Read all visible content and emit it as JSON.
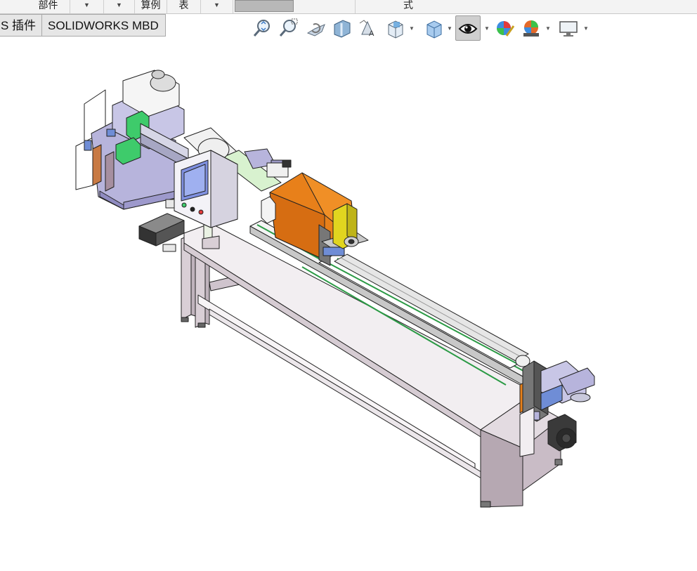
{
  "ribbon": {
    "items": [
      {
        "label": "部件"
      },
      {
        "label": "▼"
      },
      {
        "label": "▼"
      },
      {
        "label": "算例"
      },
      {
        "label": "表"
      },
      {
        "label": "▼"
      },
      {
        "label": ""
      },
      {
        "label": "式"
      }
    ]
  },
  "tabs": [
    {
      "label": "S 插件"
    },
    {
      "label": "SOLIDWORKS MBD"
    }
  ],
  "hud": {
    "tools": [
      {
        "icon": "zoom-to-fit-icon"
      },
      {
        "icon": "zoom-to-area-icon"
      },
      {
        "icon": "previous-view-icon"
      },
      {
        "icon": "section-view-icon"
      },
      {
        "icon": "dynamic-annotation-views-icon"
      },
      {
        "icon": "view-orientation-icon"
      },
      {
        "icon": "display-style-icon"
      },
      {
        "icon": "hide-show-items-icon"
      },
      {
        "icon": "edit-appearance-icon"
      },
      {
        "icon": "apply-scene-icon"
      },
      {
        "icon": "view-settings-icon"
      }
    ]
  },
  "model": {
    "name": "tube-cutting-machine-assembly",
    "colors": {
      "frame": "#d9cfd6",
      "guard": "#e8801a",
      "yellow": "#e1d51f",
      "lilac": "#b7b4dc",
      "green": "#3ecb6b",
      "mint": "#d8f2cf",
      "dark": "#3a3a3a"
    }
  }
}
